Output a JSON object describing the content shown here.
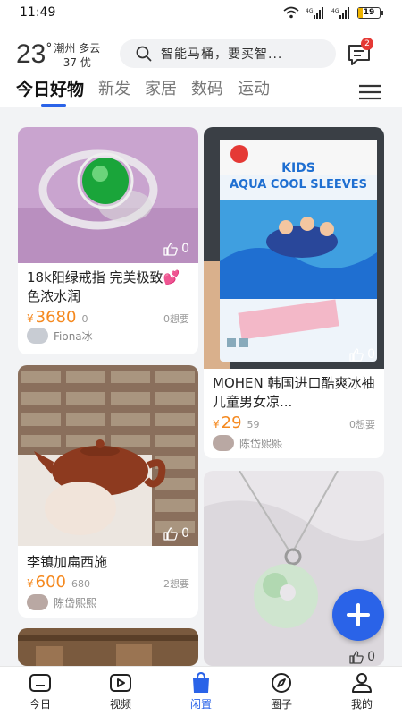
{
  "status": {
    "time": "11:49",
    "network": "4G",
    "battery": "19"
  },
  "weather": {
    "temp": "23",
    "unit": "°",
    "city": "潮州 多云",
    "aqi": "37 优"
  },
  "search": {
    "placeholder": "智能马桶，要买智..."
  },
  "messages": {
    "badge": "2"
  },
  "tabs": [
    {
      "label": "今日好物",
      "active": true
    },
    {
      "label": "新发"
    },
    {
      "label": "家居"
    },
    {
      "label": "数码"
    },
    {
      "label": "运动"
    }
  ],
  "feed": {
    "left": [
      {
        "likes": "0",
        "title": "18k阳绿戒指 完美极致💕色浓水润",
        "currency": "¥",
        "price": "3680",
        "orig": "0",
        "want": "0想要",
        "seller": "Fiona冰"
      },
      {
        "likes": "0",
        "title": "李镇加扁西施",
        "currency": "¥",
        "price": "600",
        "orig": "680",
        "want": "2想要",
        "seller": "陈岱熙熙"
      }
    ],
    "right": [
      {
        "likes": "0",
        "title": "MOHEN 韩国进口酷爽冰袖儿童男女凉...",
        "currency": "¥",
        "price": "29",
        "orig": "59",
        "want": "0想要",
        "seller": "陈岱熙熙",
        "package_text": "KIDS AQUA COOL SLEEVES"
      },
      {
        "likes": "0"
      }
    ]
  },
  "bottom_nav": [
    {
      "label": "今日",
      "icon": "home-icon"
    },
    {
      "label": "视频",
      "icon": "video-icon"
    },
    {
      "label": "闲置",
      "icon": "shopping-bag-icon",
      "active": true
    },
    {
      "label": "圈子",
      "icon": "compass-icon"
    },
    {
      "label": "我的",
      "icon": "person-icon"
    }
  ],
  "colors": {
    "accent": "#2a63e8",
    "price": "#f5891f",
    "badge": "#e53935"
  }
}
